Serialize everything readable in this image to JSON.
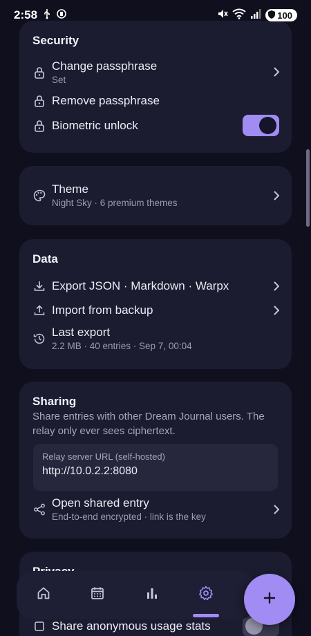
{
  "status": {
    "time": "2:58",
    "battery": "100"
  },
  "security": {
    "title": "Security",
    "change_passphrase": {
      "label": "Change passphrase",
      "sub": "Set"
    },
    "remove_passphrase": {
      "label": "Remove passphrase"
    },
    "biometric_unlock": {
      "label": "Biometric unlock",
      "enabled": true
    }
  },
  "appearance": {
    "theme": {
      "label": "Theme",
      "sub": "Night Sky · 6 premium themes"
    }
  },
  "data": {
    "title": "Data",
    "export": {
      "label": "Export JSON · Markdown · Warpx"
    },
    "import": {
      "label": "Import from backup"
    },
    "last_export": {
      "label": "Last export",
      "sub": "2.2 MB · 40 entries · Sep 7, 00:04"
    }
  },
  "sharing": {
    "title": "Sharing",
    "description": "Share entries with other Dream Journal users. The relay only ever sees ciphertext.",
    "relay": {
      "label": "Relay server URL (self-hosted)",
      "value": "http://10.0.2.2:8080"
    },
    "open_shared": {
      "label": "Open shared entry",
      "sub": "End-to-end encrypted · link is the key"
    }
  },
  "privacy": {
    "title": "Privacy",
    "usage_stats": {
      "label": "Share anonymous usage stats",
      "enabled": false
    }
  },
  "nav": {
    "items": [
      "home-icon",
      "calendar-icon",
      "stats-icon",
      "settings-icon"
    ],
    "active": "settings"
  },
  "colors": {
    "background": "#0f0f1e",
    "card": "#1c1c31",
    "accent": "#a08cf2"
  }
}
